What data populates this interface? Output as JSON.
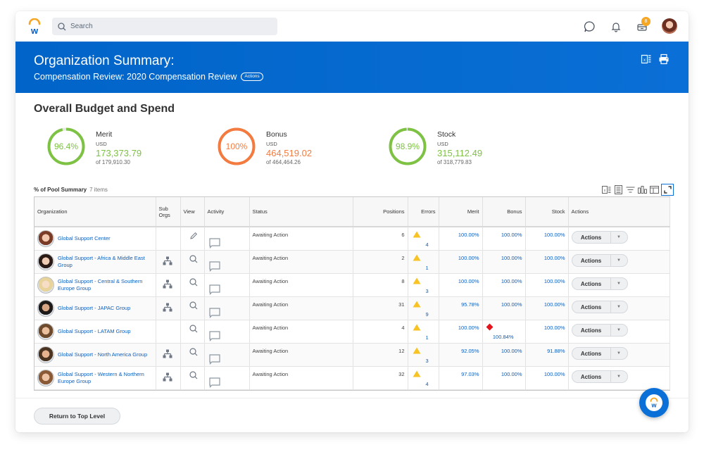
{
  "topbar": {
    "logo": "workday-logo-icon",
    "search_placeholder": "Search",
    "icons": [
      "chat-icon",
      "bell-icon",
      "inbox-icon",
      "avatar"
    ],
    "inbox_badge": "8"
  },
  "header": {
    "title": "Organization Summary:",
    "subtitle": "Compensation Review: 2020 Compensation Review",
    "actions_label": "Actions",
    "icons": [
      "export-excel-icon",
      "print-icon"
    ]
  },
  "budget": {
    "title": "Overall Budget and Spend",
    "items": [
      {
        "label": "Merit",
        "currency": "USD",
        "value": "173,373.79",
        "of": "of 179,910.30",
        "percent_label": "96.4%",
        "percent": 96.4,
        "color": "#7dc243"
      },
      {
        "label": "Bonus",
        "currency": "USD",
        "value": "464,519.02",
        "of": "of 464,464.26",
        "percent_label": "100%",
        "percent": 100,
        "color": "#f47b3f"
      },
      {
        "label": "Stock",
        "currency": "USD",
        "value": "315,112.49",
        "of": "of 318,779.83",
        "percent_label": "98.9%",
        "percent": 98.9,
        "color": "#7dc243"
      }
    ]
  },
  "grid": {
    "title": "% of Pool Summary",
    "count": "7 items",
    "toolbar_icons": [
      "export-excel-icon",
      "worksheet-icon",
      "filter-icon",
      "chart-icon",
      "column-layout-icon",
      "fullscreen-icon"
    ],
    "columns": [
      "Organization",
      "Sub Orgs",
      "View",
      "Activity",
      "Status",
      "Positions",
      "Errors",
      "Merit",
      "Bonus",
      "Stock",
      "Actions"
    ],
    "rows": [
      {
        "org": "Global Support Center",
        "sub_orgs": false,
        "view": "edit",
        "status": "Awaiting Action",
        "positions": "6",
        "errors": "4",
        "merit": "100.00%",
        "bonus": "100.00%",
        "bonus_flag": false,
        "stock": "100.00%",
        "action": "Actions"
      },
      {
        "org": "Global Support - Africa & Middle East Group",
        "sub_orgs": true,
        "view": "search",
        "status": "Awaiting Action",
        "positions": "2",
        "errors": "1",
        "merit": "100.00%",
        "bonus": "100.00%",
        "bonus_flag": false,
        "stock": "100.00%",
        "action": "Actions"
      },
      {
        "org": "Global Support - Central & Southern Europe Group",
        "sub_orgs": true,
        "view": "search",
        "status": "Awaiting Action",
        "positions": "8",
        "errors": "3",
        "merit": "100.00%",
        "bonus": "100.00%",
        "bonus_flag": false,
        "stock": "100.00%",
        "action": "Actions"
      },
      {
        "org": "Global Support - JAPAC Group",
        "sub_orgs": true,
        "view": "search",
        "status": "Awaiting Action",
        "positions": "31",
        "errors": "9",
        "merit": "95.78%",
        "bonus": "100.00%",
        "bonus_flag": false,
        "stock": "100.00%",
        "action": "Actions"
      },
      {
        "org": "Global Support - LATAM Group",
        "sub_orgs": false,
        "view": "search",
        "status": "Awaiting Action",
        "positions": "4",
        "errors": "1",
        "merit": "100.00%",
        "bonus": "100.84%",
        "bonus_flag": true,
        "stock": "100.00%",
        "action": "Actions"
      },
      {
        "org": "Global Support - North America Group",
        "sub_orgs": true,
        "view": "search",
        "status": "Awaiting Action",
        "positions": "12",
        "errors": "3",
        "merit": "92.05%",
        "bonus": "100.00%",
        "bonus_flag": false,
        "stock": "91.88%",
        "action": "Actions"
      },
      {
        "org": "Global Support - Western & Northern Europe Group",
        "sub_orgs": true,
        "view": "search",
        "status": "Awaiting Action",
        "positions": "32",
        "errors": "4",
        "merit": "97.03%",
        "bonus": "100.00%",
        "bonus_flag": false,
        "stock": "100.00%",
        "action": "Actions"
      }
    ]
  },
  "footer": {
    "return_label": "Return to Top Level",
    "assistant_icon": "workday-assistant-icon"
  }
}
